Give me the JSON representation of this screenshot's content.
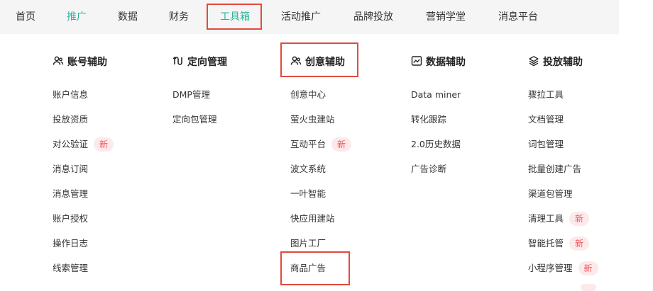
{
  "nav": {
    "items": [
      {
        "label": "首页"
      },
      {
        "label": "推广",
        "active": true
      },
      {
        "label": "数据"
      },
      {
        "label": "财务"
      },
      {
        "label": "工具箱",
        "active": true
      },
      {
        "label": "活动推广"
      },
      {
        "label": "品牌投放"
      },
      {
        "label": "营销学堂"
      },
      {
        "label": "消息平台"
      }
    ],
    "active_color": "#29b49c"
  },
  "columns": [
    {
      "title": "账号辅助",
      "icon": "users-icon",
      "items": [
        {
          "label": "账户信息"
        },
        {
          "label": "投放资质"
        },
        {
          "label": "对公验证",
          "badge": "新"
        },
        {
          "label": "消息订阅"
        },
        {
          "label": "消息管理"
        },
        {
          "label": "账户授权"
        },
        {
          "label": "操作日志"
        },
        {
          "label": "线索管理"
        }
      ]
    },
    {
      "title": "定向管理",
      "icon": "route-icon",
      "items": [
        {
          "label": "DMP管理"
        },
        {
          "label": "定向包管理"
        }
      ]
    },
    {
      "title": "创意辅助",
      "icon": "users-icon",
      "items": [
        {
          "label": "创意中心"
        },
        {
          "label": "萤火虫建站"
        },
        {
          "label": "互动平台",
          "badge": "新"
        },
        {
          "label": "波文系统"
        },
        {
          "label": "一叶智能"
        },
        {
          "label": "快应用建站"
        },
        {
          "label": "图片工厂"
        },
        {
          "label": "商品广告"
        }
      ]
    },
    {
      "title": "数据辅助",
      "icon": "chart-icon",
      "items": [
        {
          "label": "Data miner"
        },
        {
          "label": "转化跟踪"
        },
        {
          "label": "2.0历史数据"
        },
        {
          "label": "广告诊断"
        }
      ]
    },
    {
      "title": "投放辅助",
      "icon": "layers-icon",
      "items": [
        {
          "label": "骤拉工具"
        },
        {
          "label": "文档管理"
        },
        {
          "label": "词包管理"
        },
        {
          "label": "批量创建广告"
        },
        {
          "label": "渠道包管理"
        },
        {
          "label": "清理工具",
          "badge": "新"
        },
        {
          "label": "智能托管",
          "badge": "新"
        },
        {
          "label": "小程序管理",
          "badge": "新"
        }
      ]
    }
  ],
  "colors": {
    "accent": "#29b49c",
    "highlight_border": "#e24a3d",
    "badge_bg": "#fde9ea",
    "badge_text": "#ec5a62"
  }
}
